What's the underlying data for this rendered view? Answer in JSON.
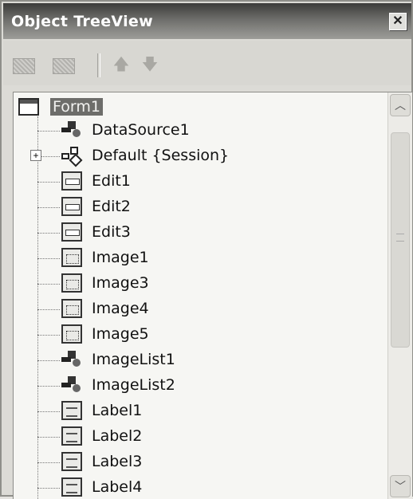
{
  "window": {
    "title": "Object TreeView",
    "close_label": "✕"
  },
  "toolbar": {
    "buttons": [
      {
        "name": "add-object-icon",
        "label": ""
      },
      {
        "name": "remove-object-icon",
        "label": ""
      }
    ],
    "move_up_glyph": "🡅",
    "move_down_glyph": "🡇"
  },
  "tree": {
    "root": "Form1",
    "items": [
      {
        "label": "DataSource1",
        "icon": "component-icon"
      },
      {
        "label": "Default {Session}",
        "icon": "session-icon",
        "expandable": true,
        "expander": "+"
      },
      {
        "label": "Edit1",
        "icon": "edit-icon"
      },
      {
        "label": "Edit2",
        "icon": "edit-icon"
      },
      {
        "label": "Edit3",
        "icon": "edit-icon"
      },
      {
        "label": "Image1",
        "icon": "image-icon"
      },
      {
        "label": "Image3",
        "icon": "image-icon"
      },
      {
        "label": "Image4",
        "icon": "image-icon"
      },
      {
        "label": "Image5",
        "icon": "image-icon"
      },
      {
        "label": "ImageList1",
        "icon": "component-icon"
      },
      {
        "label": "ImageList2",
        "icon": "component-icon"
      },
      {
        "label": "Label1",
        "icon": "label-icon"
      },
      {
        "label": "Label2",
        "icon": "label-icon"
      },
      {
        "label": "Label3",
        "icon": "label-icon"
      },
      {
        "label": "Label4",
        "icon": "label-icon"
      }
    ]
  },
  "scrollbar": {
    "up_glyph": "︿",
    "down_glyph": "﹀"
  }
}
